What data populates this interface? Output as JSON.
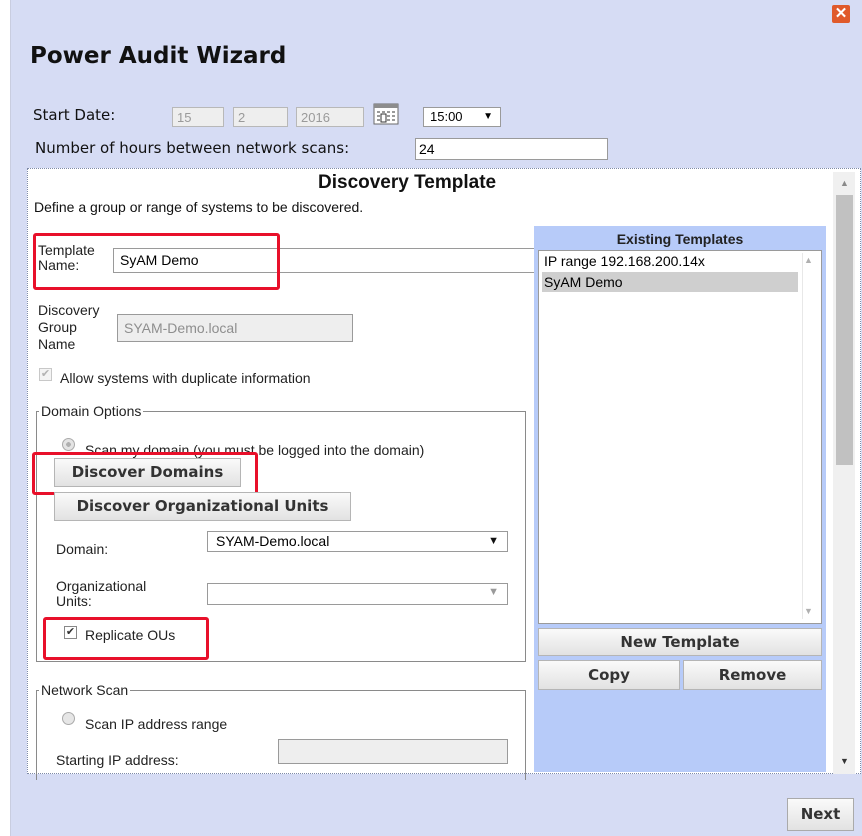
{
  "dialog": {
    "title": "Power Audit Wizard",
    "close_glyph": "✕"
  },
  "schedule": {
    "start_date_label": "Start Date:",
    "day": "15",
    "month": "2",
    "year": "2016",
    "time": "15:00",
    "time_arrow": "▼",
    "hours_label": "Number of hours between network scans:",
    "hours_value": "24"
  },
  "template": {
    "heading": "Discovery Template",
    "description": "Define a group or range of systems to be discovered.",
    "name_label_1": "Template",
    "name_label_2": "Name:",
    "name_value": "SyAM Demo",
    "group_label_1": "Discovery",
    "group_label_2": "Group",
    "group_label_3": "Name",
    "group_value": "SYAM-Demo.local",
    "duplicate_label": "Allow systems with duplicate information"
  },
  "domain_options": {
    "legend": "Domain Options",
    "scan_domain_label": "Scan my domain (you must be logged into the domain)",
    "discover_domains_button": "Discover Domains",
    "discover_ous_button": "Discover Organizational Units",
    "domain_label": "Domain:",
    "domain_value": "SYAM-Demo.local",
    "domain_arrow": "▼",
    "ou_label_1": "Organizational",
    "ou_label_2": "Units:",
    "ou_arrow": "▼",
    "replicate_label": "Replicate OUs",
    "check_glyph": "✔"
  },
  "network_scan": {
    "legend": "Network Scan",
    "scan_range_label": "Scan IP address range",
    "starting_ip_label": "Starting IP address:"
  },
  "existing_templates": {
    "heading": "Existing Templates",
    "items": [
      "IP range 192.168.200.14x",
      "SyAM Demo"
    ],
    "new_button": "New Template",
    "copy_button": "Copy",
    "remove_button": "Remove",
    "scroll_up": "▲",
    "scroll_down": "▼"
  },
  "footer": {
    "next_button": "Next"
  }
}
